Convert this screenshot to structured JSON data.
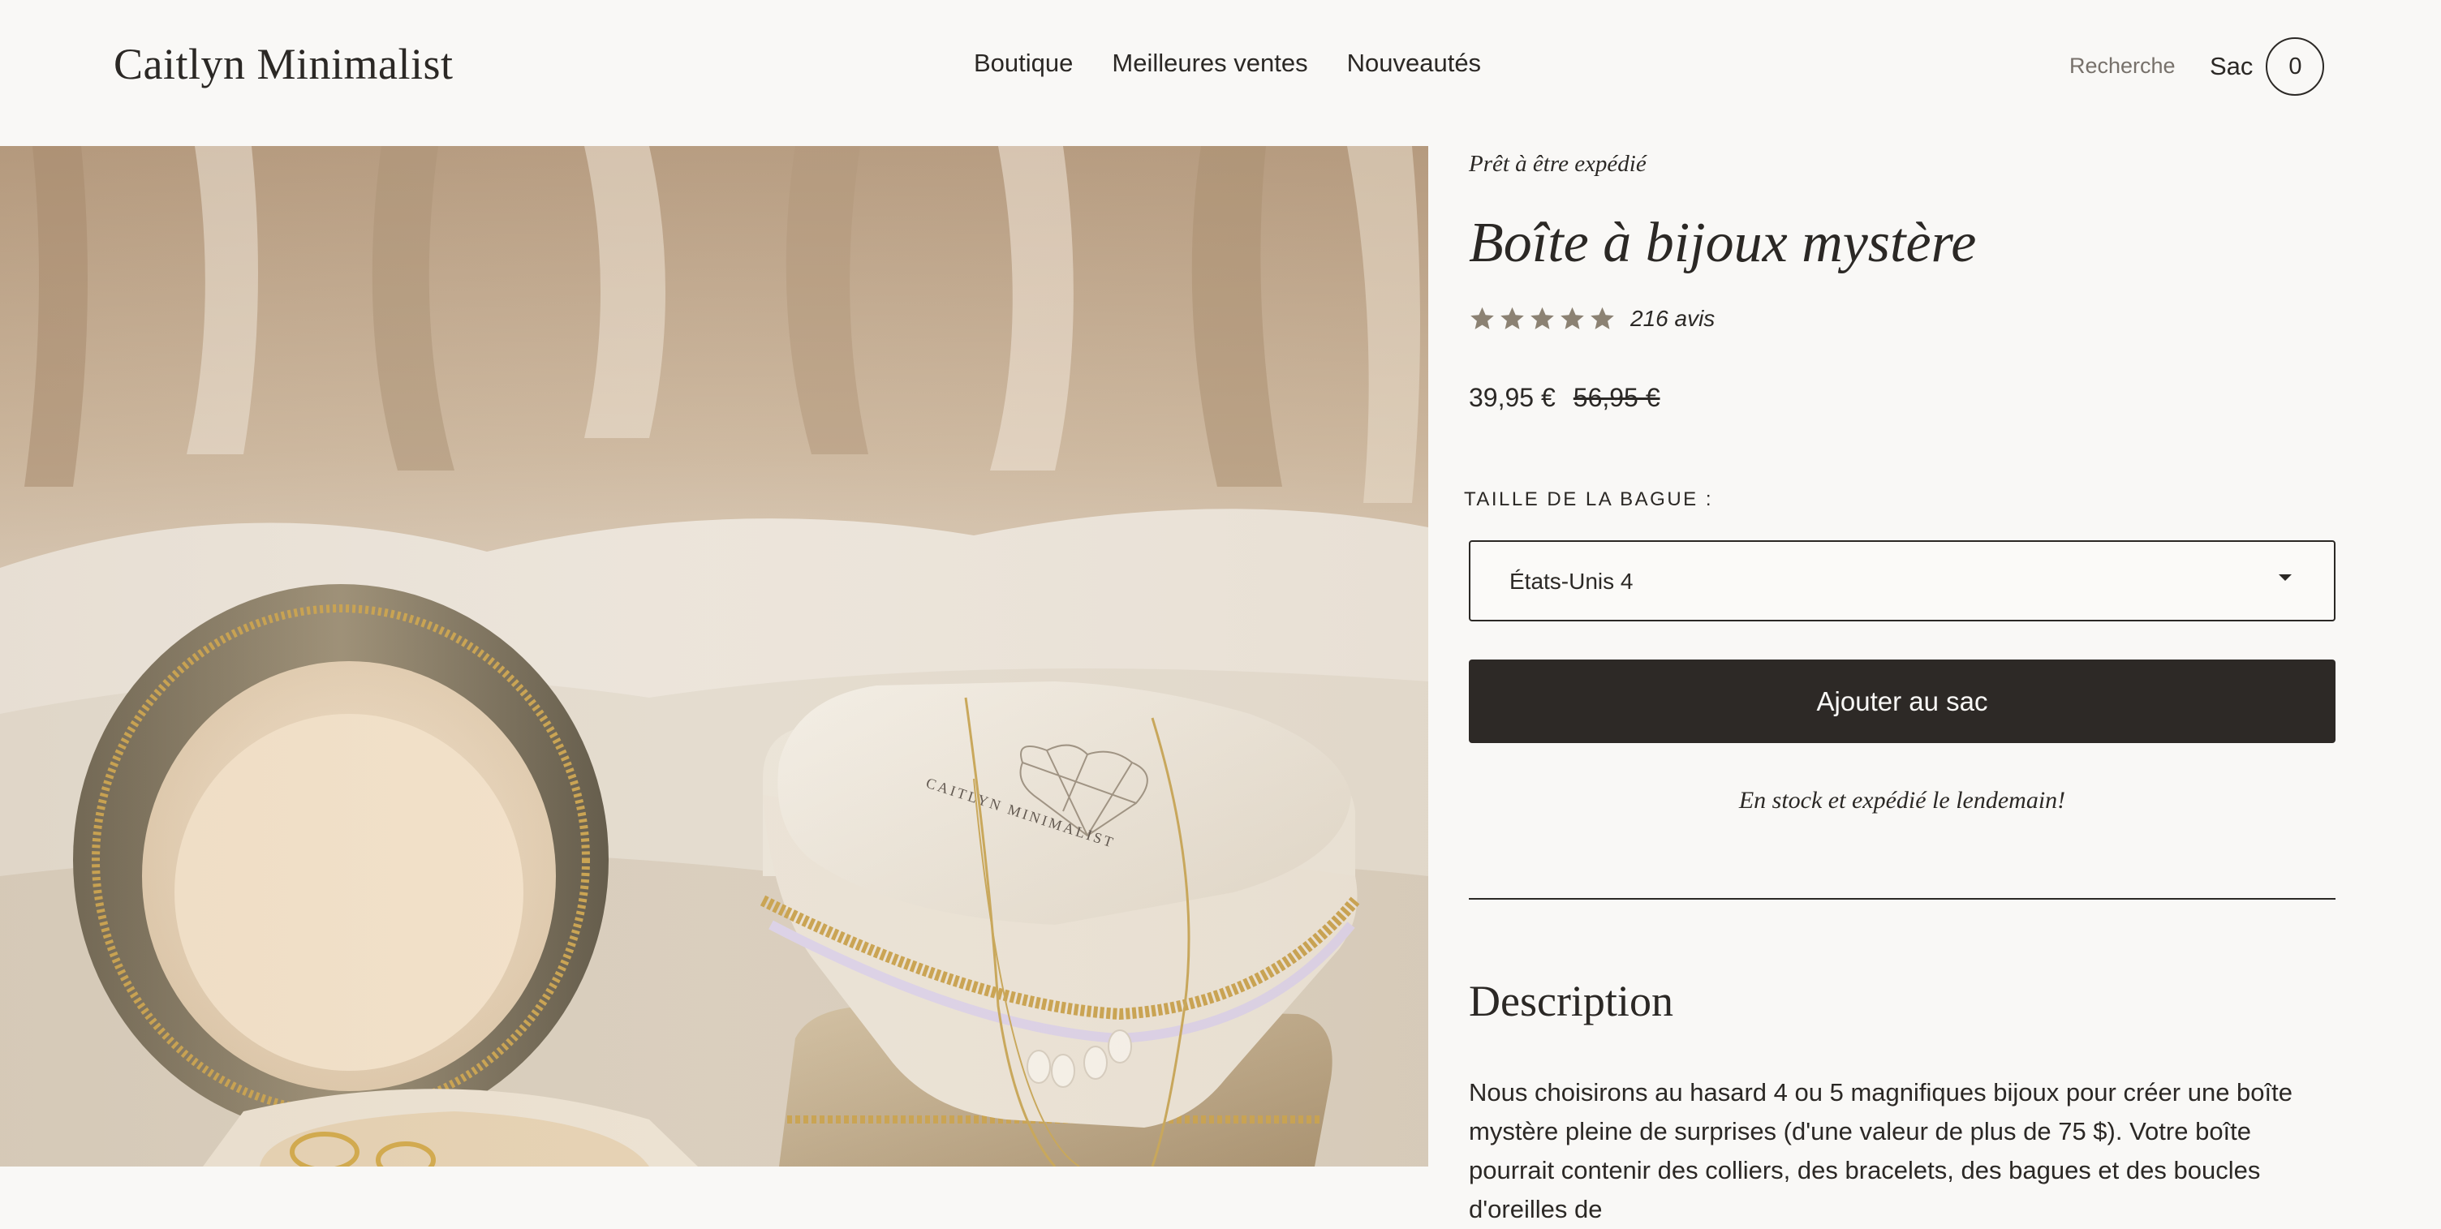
{
  "header": {
    "logo": "Caitlyn Minimalist",
    "nav": [
      "Boutique",
      "Meilleures ventes",
      "Nouveautés"
    ],
    "search_label": "Recherche",
    "bag_label": "Sac",
    "bag_count": "0"
  },
  "product": {
    "shipping_tag": "Prêt à être expédié",
    "title": "Boîte à bijoux mystère",
    "rating": 5,
    "reviews_label": "216 avis",
    "price": "39,95 €",
    "original_price": "56,95 €",
    "size_label": "TAILLE DE LA BAGUE :",
    "size_selected": "États-Unis 4",
    "add_button_label": "Ajouter au sac",
    "stock_note": "En stock et expédié le lendemain!",
    "description_heading": "Description",
    "description_text": "Nous choisirons au hasard 4 ou 5 magnifiques bijoux pour créer une boîte mystère pleine de surprises (d'une valeur de plus de 75 $). Votre boîte pourrait contenir des colliers, des bracelets, des bagues et des boucles d'oreilles de"
  },
  "product_image": {
    "box_brand_text": "CAITLYN MINIMALIST"
  },
  "colors": {
    "background": "#f9f8f6",
    "text": "#2b2825",
    "button_bg": "#2d2926",
    "star": "#8c8273"
  },
  "icons": {
    "star": "star-icon",
    "select_caret": "chevron-down-icon"
  }
}
